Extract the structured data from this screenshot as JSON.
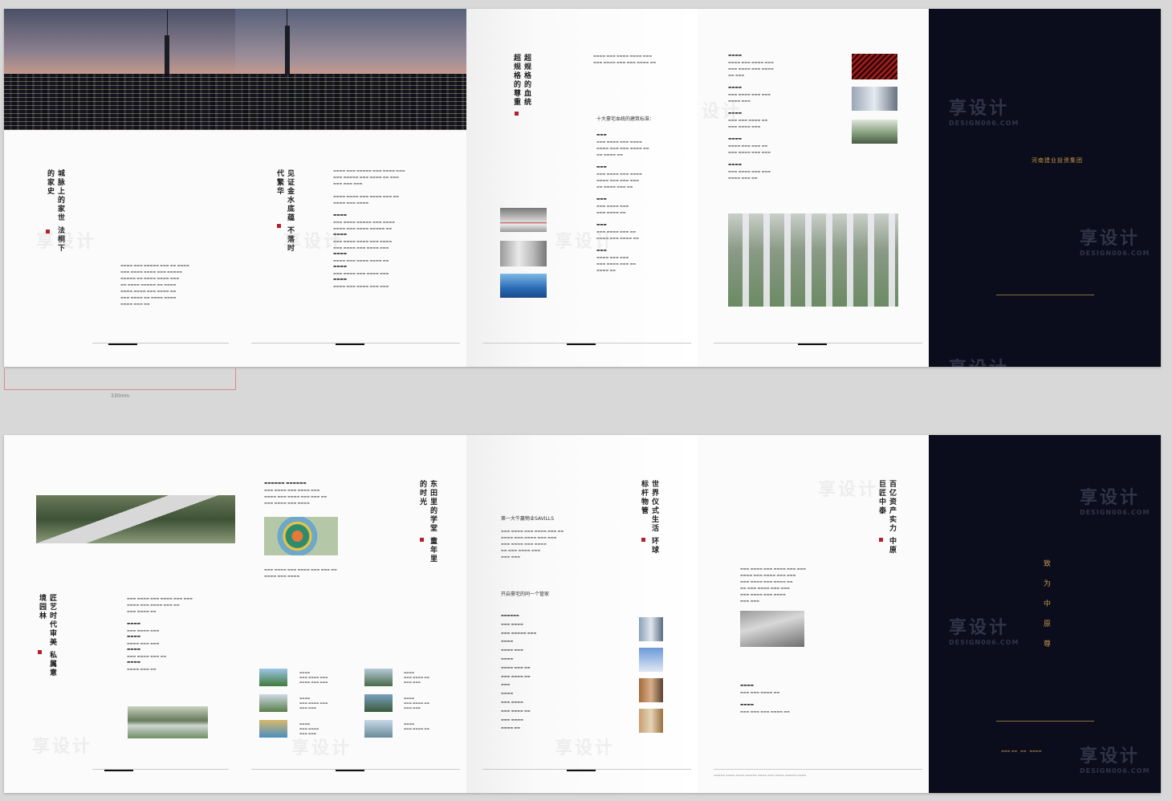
{
  "top_spread": {
    "p1": {
      "title": "城脉上的家世 法桐下的家史"
    },
    "p2": {
      "title": "见证金水底蕴 不落时代繁华"
    },
    "p3": {
      "title": "超规格的血统 超规格的尊重",
      "heading": "十大豪宅血统的建筑标准："
    },
    "p5": {
      "logo": "河南建业投资集团"
    }
  },
  "ruler_label": "330mm",
  "bottom_spread": {
    "p1": {
      "title": "匠艺时代审美 私属意境园林"
    },
    "p2": {
      "title": "东田里的学堂 童年里的时光"
    },
    "p3": {
      "title": "世界仪式生活 环球标杆物管",
      "heading1": "第一大牛赢物业SAVILLS",
      "heading2": "开启豪宅的同一个管家"
    },
    "p4": {
      "title": "百亿资产实力 中原巨匠中泰"
    },
    "p5": {
      "slogan": "致为中原尊"
    }
  },
  "watermark": {
    "text": "享设计",
    "sub": "DESIGN006.COM"
  },
  "colors": {
    "dark_panel": "#0b0d1d",
    "gold": "#c59747",
    "seal": "#b3202a"
  }
}
